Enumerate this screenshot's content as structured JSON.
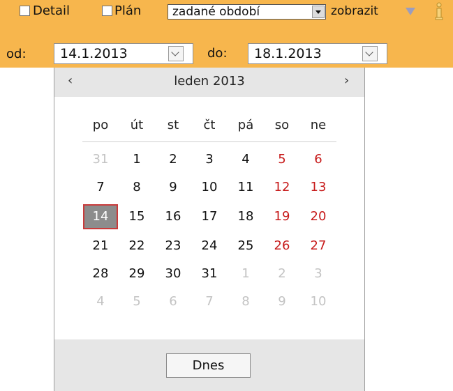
{
  "toolbar": {
    "detail_label": "Detail",
    "plan_label": "Plán",
    "period_select_value": "zadané období",
    "show_label": "zobrazit"
  },
  "dates": {
    "from_label": "od:",
    "from_value": "14.1.2013",
    "to_label": "do:",
    "to_value": "18.1.2013"
  },
  "calendar": {
    "prev": "‹",
    "next": "›",
    "month_label": "leden 2013",
    "weekdays": [
      "po",
      "út",
      "st",
      "čt",
      "pá",
      "so",
      "ne"
    ],
    "weeks": [
      [
        "31",
        "1",
        "2",
        "3",
        "4",
        "5",
        "6"
      ],
      [
        "7",
        "8",
        "9",
        "10",
        "11",
        "12",
        "13"
      ],
      [
        "14",
        "15",
        "16",
        "17",
        "18",
        "19",
        "20"
      ],
      [
        "21",
        "22",
        "23",
        "24",
        "25",
        "26",
        "27"
      ],
      [
        "28",
        "29",
        "30",
        "31",
        "1",
        "2",
        "3"
      ],
      [
        "4",
        "5",
        "6",
        "7",
        "8",
        "9",
        "10"
      ]
    ],
    "today_button": "Dnes"
  },
  "colors": {
    "toolbar_bg": "#f7b64d",
    "weekend": "#c71b1b",
    "selected_bg": "#8c8c8c",
    "selected_border": "#c93a3a",
    "muted": "#c3c3c3"
  },
  "icons": {
    "show_options": "triangle-down-icon",
    "info": "info-icon"
  }
}
